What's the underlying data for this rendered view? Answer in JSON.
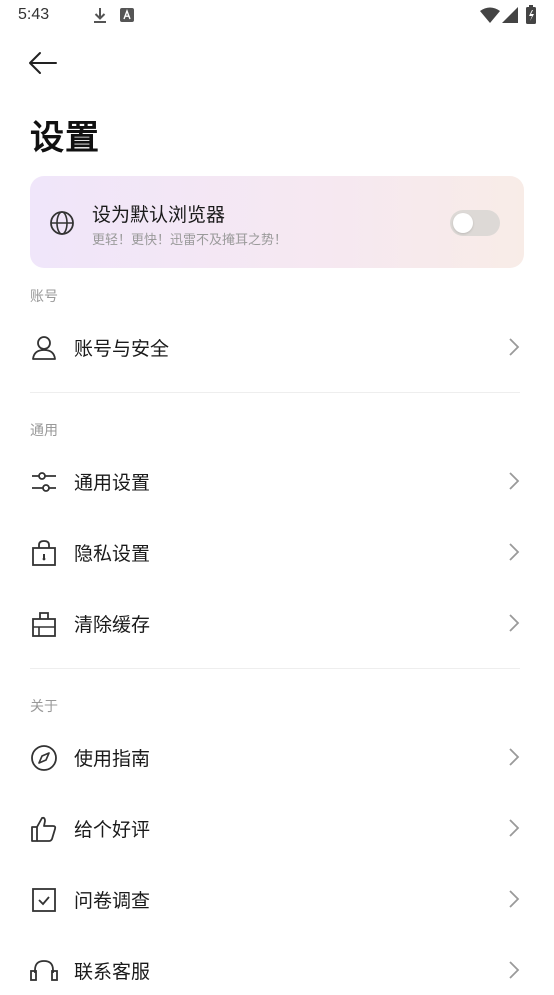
{
  "status_bar": {
    "time": "5:43",
    "icons": [
      "download-icon",
      "a-notification-icon",
      "wifi-icon",
      "signal-icon",
      "battery-icon"
    ]
  },
  "header": {
    "back_icon": "arrow-left-icon",
    "title": "设置"
  },
  "default_browser_card": {
    "icon": "globe-icon",
    "title": "设为默认浏览器",
    "subtitle": "更轻！更快！迅雷不及掩耳之势！",
    "toggle_on": false,
    "gradient_colors": [
      "#f0e6fa",
      "#f8ece7"
    ]
  },
  "sections": [
    {
      "header": "账号",
      "items": [
        {
          "label": "账号与安全",
          "icon": "user-icon"
        }
      ]
    },
    {
      "header": "通用",
      "items": [
        {
          "label": "通用设置",
          "icon": "sliders-icon"
        },
        {
          "label": "隐私设置",
          "icon": "lock-bag-icon"
        },
        {
          "label": "清除缓存",
          "icon": "broom-box-icon"
        }
      ]
    },
    {
      "header": "关于",
      "items": [
        {
          "label": "使用指南",
          "icon": "compass-icon"
        },
        {
          "label": "给个好评",
          "icon": "thumbs-up-icon"
        },
        {
          "label": "问卷调查",
          "icon": "checkbox-icon"
        },
        {
          "label": "联系客服",
          "icon": "headset-icon"
        }
      ]
    }
  ],
  "colors": {
    "text_primary": "#1a1a1a",
    "text_secondary": "#999999",
    "chevron": "#9a9a9a",
    "toggle_off": "#ddd9d6",
    "divider": "#eeeeee"
  }
}
